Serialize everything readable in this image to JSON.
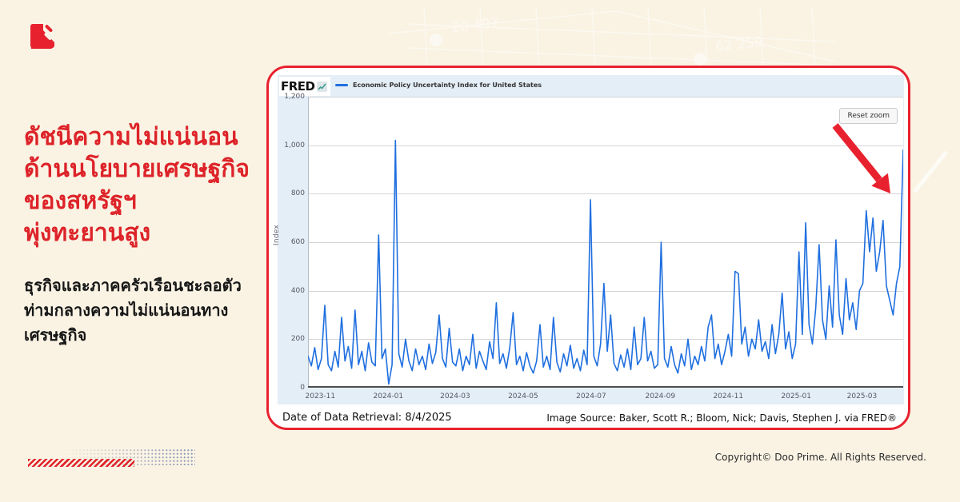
{
  "page": {
    "background_color": "#faf3e4",
    "copyright": "Copyright© Doo Prime. All Rights Reserved."
  },
  "brand": {
    "accent_red": "#e8212e",
    "logo_name": "doo-prime-logo"
  },
  "headline": {
    "color": "#dd2329",
    "lines": [
      "ดัชนีความไม่แน่นอน",
      "ด้านนโยบายเศรษฐกิจ",
      "ของสหรัฐฯ",
      "พุ่งทะยานสูง"
    ]
  },
  "subheadline": {
    "lines": [
      "ธุรกิจและภาคครัวเรือนชะลอตัว",
      "ท่ามกลางความไม่แน่นอนทาง",
      "เศรษฐกิจ"
    ]
  },
  "watermark": {
    "labels": [
      "20 497",
      "62 259"
    ]
  },
  "fred_card": {
    "logo_text": "FRED",
    "legend_label": "Economic Policy Uncertainty Index for United States",
    "reset_zoom_label": "Reset zoom",
    "footer_left": "Date of Data Retrieval: 8/4/2025",
    "footer_right": "Image Source: Baker, Scott R.; Bloom, Nick; Davis, Stephen J. via FRED®",
    "chart_bg": "#e4eef7"
  },
  "chart_data": {
    "type": "line",
    "title": "Economic Policy Uncertainty Index for United States",
    "series_name": "Economic Policy Uncertainty Index for United States",
    "xlabel": "",
    "ylabel": "Index",
    "ylim": [
      0,
      1200
    ],
    "grid": true,
    "legend_position": "top-left",
    "line_color": "#1f6fdf",
    "x_range": [
      "2023-10-21",
      "2025-04-07"
    ],
    "x_ticks": [
      {
        "f": 0.0206,
        "label": "2023-11"
      },
      {
        "f": 0.1348,
        "label": "2024-01"
      },
      {
        "f": 0.2472,
        "label": "2024-03"
      },
      {
        "f": 0.3614,
        "label": "2024-05"
      },
      {
        "f": 0.4757,
        "label": "2024-07"
      },
      {
        "f": 0.5918,
        "label": "2024-09"
      },
      {
        "f": 0.706,
        "label": "2024-11"
      },
      {
        "f": 0.8202,
        "label": "2025-01"
      },
      {
        "f": 0.9307,
        "label": "2025-03"
      }
    ],
    "y_ticks": [
      {
        "v": 0,
        "label": "0"
      },
      {
        "v": 200,
        "label": "200"
      },
      {
        "v": 400,
        "label": "400"
      },
      {
        "v": 600,
        "label": "600"
      },
      {
        "v": 800,
        "label": "800"
      },
      {
        "v": 1000,
        "label": "1,000"
      },
      {
        "v": 1200,
        "label": "1,200"
      }
    ],
    "annotations": [
      {
        "type": "arrow",
        "color": "#e8212e",
        "note": "points to final spike ≈980 in 2025-04"
      }
    ],
    "values": [
      130,
      90,
      165,
      75,
      120,
      340,
      95,
      70,
      150,
      85,
      290,
      110,
      170,
      80,
      320,
      95,
      150,
      70,
      185,
      105,
      90,
      630,
      120,
      160,
      15,
      95,
      1020,
      140,
      85,
      200,
      110,
      70,
      160,
      95,
      130,
      75,
      180,
      100,
      145,
      300,
      120,
      85,
      245,
      105,
      90,
      160,
      70,
      130,
      95,
      220,
      80,
      150,
      110,
      75,
      190,
      120,
      350,
      100,
      140,
      80,
      165,
      310,
      95,
      130,
      70,
      145,
      90,
      60,
      110,
      260,
      85,
      130,
      75,
      290,
      105,
      65,
      140,
      90,
      175,
      80,
      120,
      70,
      155,
      95,
      775,
      130,
      90,
      180,
      430,
      150,
      300,
      100,
      70,
      135,
      85,
      160,
      75,
      250,
      95,
      120,
      290,
      110,
      150,
      80,
      95,
      600,
      120,
      85,
      170,
      95,
      60,
      140,
      90,
      200,
      75,
      130,
      95,
      170,
      110,
      250,
      300,
      120,
      180,
      95,
      150,
      220,
      130,
      480,
      470,
      180,
      250,
      130,
      200,
      160,
      280,
      150,
      190,
      120,
      260,
      140,
      220,
      390,
      160,
      230,
      120,
      180,
      560,
      220,
      680,
      260,
      180,
      330,
      590,
      280,
      200,
      420,
      250,
      610,
      300,
      220,
      450,
      280,
      350,
      240,
      400,
      430,
      730,
      560,
      700,
      480,
      560,
      690,
      420,
      360,
      300,
      430,
      500,
      980
    ]
  }
}
